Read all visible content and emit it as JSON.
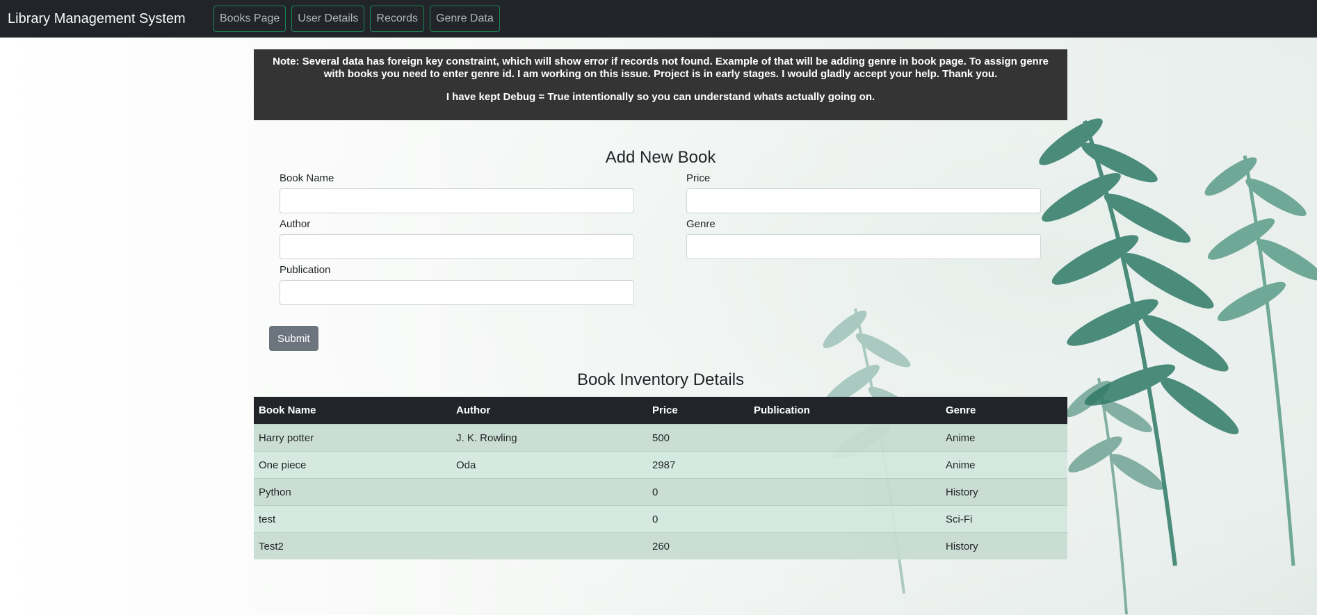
{
  "navbar": {
    "brand": "Library Management System",
    "links": [
      "Books Page",
      "User Details",
      "Records",
      "Genre Data"
    ]
  },
  "note": {
    "line1": "Note: Several data has foreign key constraint, which will show error if records not found. Example of that will be adding genre in book page. To assign genre with books you need to enter genre id. I am working on this issue. Project is in early stages. I would gladly accept your help. Thank you.",
    "line2": "I have kept Debug = True intentionally so you can understand whats actually going on."
  },
  "form": {
    "title": "Add New Book",
    "labels": {
      "book_name": "Book Name",
      "author": "Author",
      "publication": "Publication",
      "price": "Price",
      "genre": "Genre"
    },
    "values": {
      "book_name": "",
      "author": "",
      "publication": "",
      "price": "",
      "genre": ""
    },
    "submit_label": "Submit"
  },
  "inventory": {
    "title": "Book Inventory Details",
    "columns": [
      "Book Name",
      "Author",
      "Price",
      "Publication",
      "Genre"
    ],
    "rows": [
      [
        "Harry potter",
        "J. K. Rowling",
        "500",
        "",
        "Anime"
      ],
      [
        "One piece",
        "Oda",
        "2987",
        "",
        "Anime"
      ],
      [
        "Python",
        "",
        "0",
        "",
        "History"
      ],
      [
        "test",
        "",
        "0",
        "",
        "Sci-Fi"
      ],
      [
        "Test2",
        "",
        "260",
        "",
        "History"
      ]
    ]
  },
  "colors": {
    "navbar_bg": "#212529",
    "nav_border": "#198754",
    "note_bg": "#343434",
    "submit_bg": "#6c757d",
    "row_odd": "#c7dbd0",
    "row_even": "#d1e7dd"
  }
}
